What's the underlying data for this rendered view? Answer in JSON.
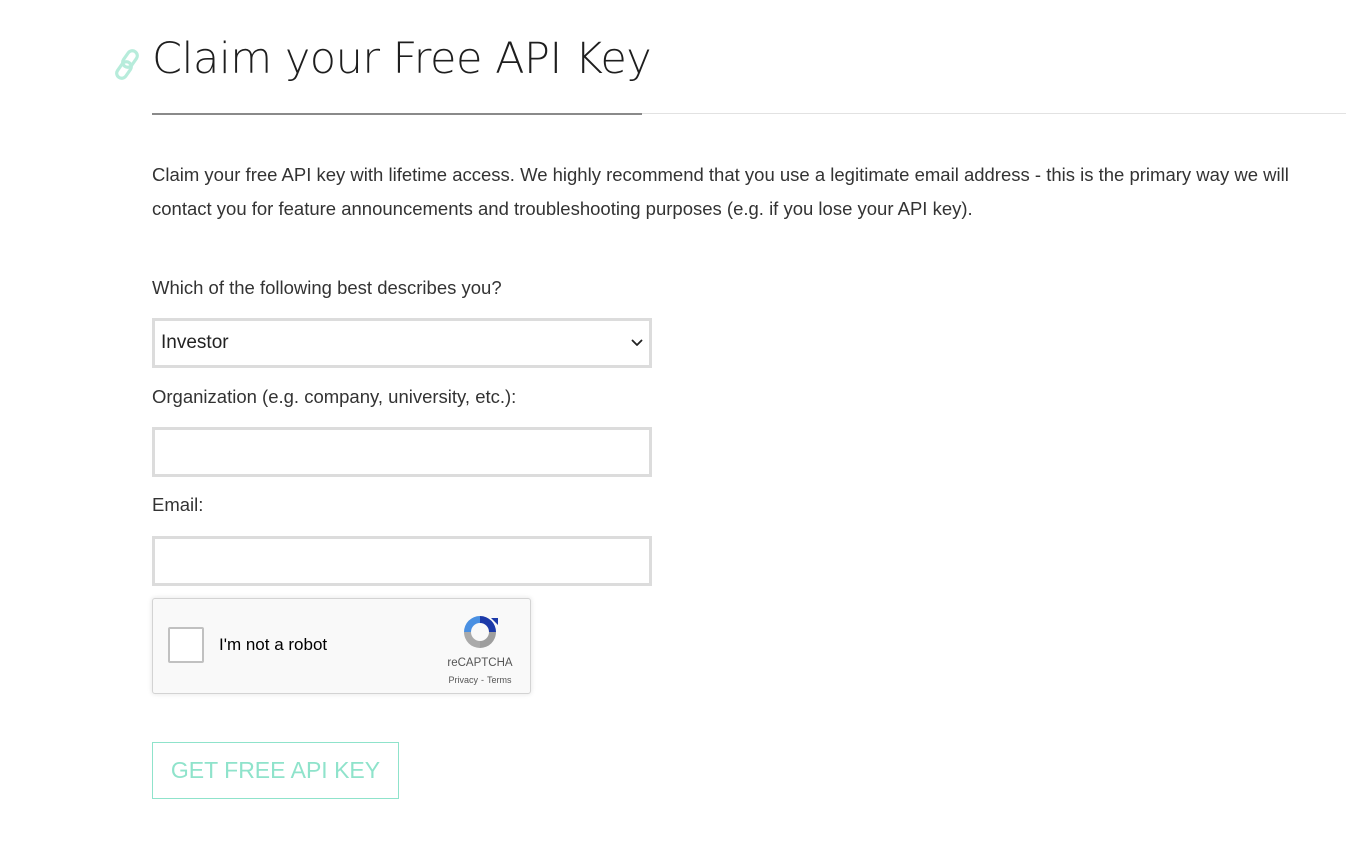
{
  "header": {
    "title": "Claim your Free API Key",
    "icon": "link-icon",
    "icon_color": "#b7ecdb"
  },
  "intro": {
    "text": "Claim your free API key with lifetime access. We highly recommend that you use a legitimate email address - this is the primary way we will contact you for feature announcements and troubleshooting purposes (e.g. if you lose your API key)."
  },
  "form": {
    "role_label": "Which of the following best describes you?",
    "role_value": "Investor",
    "organization_label": "Organization (e.g. company, university, etc.):",
    "organization_value": "",
    "email_label": "Email:",
    "email_value": ""
  },
  "recaptcha": {
    "label": "I'm not a robot",
    "brand": "reCAPTCHA",
    "privacy": "Privacy",
    "separator": "-",
    "terms": "Terms",
    "checked": false
  },
  "submit": {
    "label": "GET FREE API KEY",
    "color": "#8fe3cb"
  }
}
